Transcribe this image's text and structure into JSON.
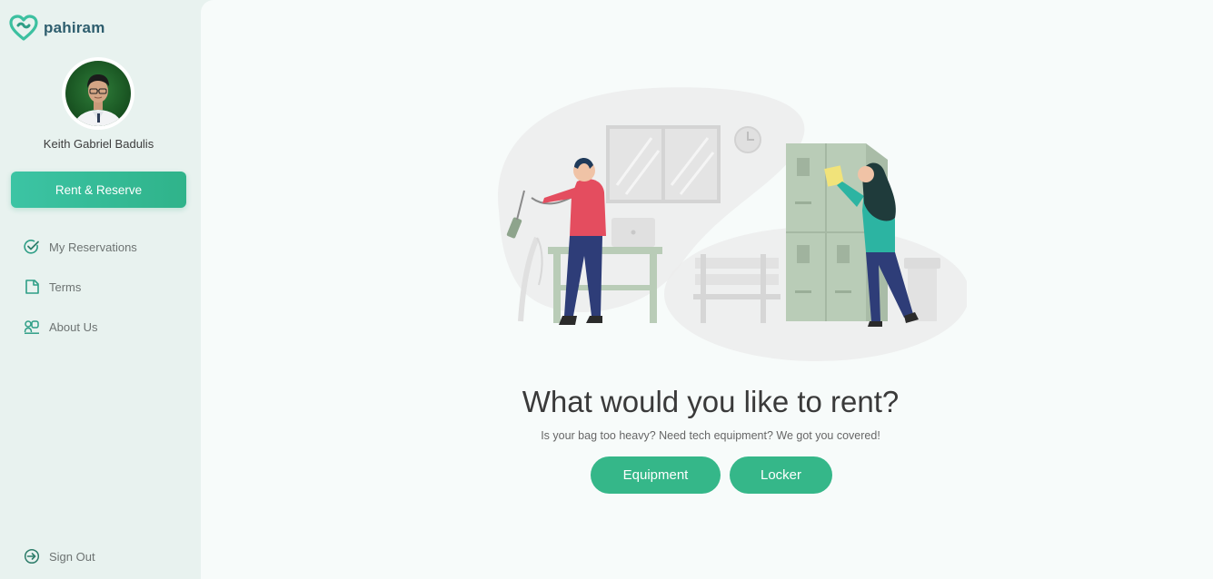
{
  "brand": {
    "name": "pahiram"
  },
  "user": {
    "name": "Keith Gabriel Badulis"
  },
  "sidebar": {
    "primary_button": "Rent & Reserve",
    "items": [
      {
        "label": "My Reservations",
        "icon": "check-icon"
      },
      {
        "label": "Terms",
        "icon": "document-icon"
      },
      {
        "label": "About Us",
        "icon": "team-icon"
      }
    ],
    "sign_out": {
      "label": "Sign Out",
      "icon": "sign-out-icon"
    }
  },
  "main": {
    "headline": "What would you like to rent?",
    "subline": "Is your bag too heavy? Need tech equipment? We got you covered!",
    "buttons": {
      "equipment": "Equipment",
      "locker": "Locker"
    }
  },
  "colors": {
    "accent": "#35b789",
    "accent_light": "#3cc4a4",
    "brand_text": "#2e5e6e",
    "sidebar_bg": "#e8f2ef",
    "main_bg": "#f7fbfa"
  }
}
